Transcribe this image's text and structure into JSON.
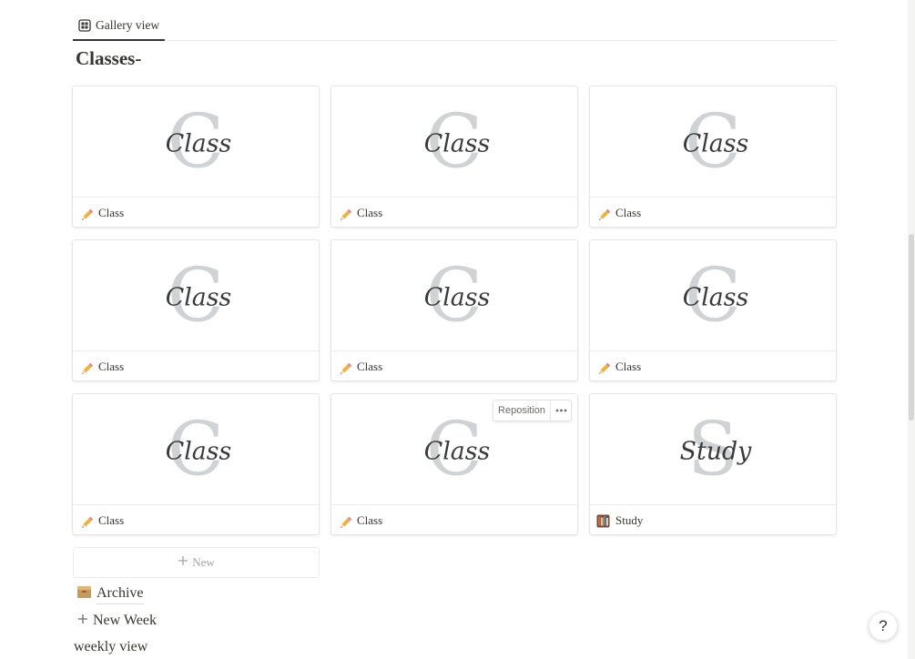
{
  "view_tab": {
    "label": "Gallery view",
    "icon": "gallery-icon"
  },
  "page": {
    "title": "Classes-"
  },
  "gallery": {
    "cards": [
      {
        "title": "Class",
        "icon": "pencil-icon",
        "cover_word": "Class",
        "cover_letter": "C"
      },
      {
        "title": "Class",
        "icon": "pencil-icon",
        "cover_word": "Class",
        "cover_letter": "C"
      },
      {
        "title": "Class",
        "icon": "pencil-icon",
        "cover_word": "Class",
        "cover_letter": "C"
      },
      {
        "title": "Class",
        "icon": "pencil-icon",
        "cover_word": "Class",
        "cover_letter": "C"
      },
      {
        "title": "Class",
        "icon": "pencil-icon",
        "cover_word": "Class",
        "cover_letter": "C"
      },
      {
        "title": "Class",
        "icon": "pencil-icon",
        "cover_word": "Class",
        "cover_letter": "C"
      },
      {
        "title": "Class",
        "icon": "pencil-icon",
        "cover_word": "Class",
        "cover_letter": "C"
      },
      {
        "title": "Class",
        "icon": "pencil-icon",
        "cover_word": "Class",
        "cover_letter": "C",
        "hover_reposition": "Reposition"
      },
      {
        "title": "Study",
        "icon": "books-icon",
        "cover_word": "Study",
        "cover_letter": "S"
      }
    ],
    "new_label": "New"
  },
  "archive": {
    "label": "Archive",
    "icon": "card-box-icon"
  },
  "new_week": {
    "label": "New Week"
  },
  "weekly_view": {
    "label": "weekly view"
  },
  "help": {
    "label": "?"
  },
  "colors": {
    "text": "#37352f",
    "muted": "#a5a4a0",
    "cover_ink": "#3a3a3a",
    "cover_letter": "#cfd3d6"
  }
}
